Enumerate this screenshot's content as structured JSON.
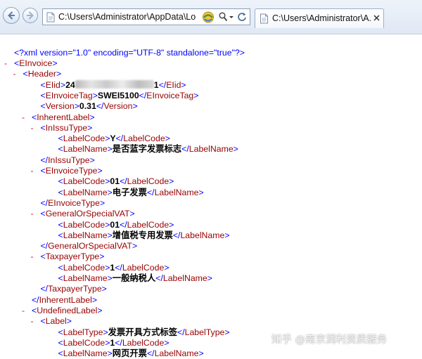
{
  "browser": {
    "address": "C:\\Users\\Administrator\\AppData\\Lo",
    "tab_title": "C:\\Users\\Administrator\\A...",
    "icons": [
      "back-icon",
      "forward-icon",
      "page-icon",
      "compat-view-icon",
      "search-icon",
      "dropdown-icon",
      "refresh-icon",
      "close-icon"
    ]
  },
  "xml": {
    "declaration": "<?xml version=\"1.0\" encoding=\"UTF-8\" standalone=\"true\"?>",
    "toggle_symbol": "-",
    "lines": [
      {
        "type": "open",
        "name": "EInvoice",
        "toggle": true
      },
      {
        "type": "open",
        "name": "Header",
        "toggle": true
      },
      {
        "type": "leaf",
        "name": "EIid",
        "value": "24",
        "redacted": true,
        "value_end": "1"
      },
      {
        "type": "leaf",
        "name": "EInvoiceTag",
        "value": "SWEI5100"
      },
      {
        "type": "leaf",
        "name": "Version",
        "value": "0.31"
      },
      {
        "type": "open",
        "name": "InherentLabel",
        "toggle": true
      },
      {
        "type": "open",
        "name": "InIssuType",
        "toggle": true
      },
      {
        "type": "leaf",
        "name": "LabelCode",
        "value": "Y"
      },
      {
        "type": "leaf",
        "name": "LabelName",
        "value": "是否蓝字发票标志"
      },
      {
        "type": "close",
        "name": "InIssuType"
      },
      {
        "type": "open",
        "name": "EInvoiceType",
        "toggle": true
      },
      {
        "type": "leaf",
        "name": "LabelCode",
        "value": "01"
      },
      {
        "type": "leaf",
        "name": "LabelName",
        "value": "电子发票"
      },
      {
        "type": "close",
        "name": "EInvoiceType"
      },
      {
        "type": "open",
        "name": "GeneralOrSpecialVAT",
        "toggle": true
      },
      {
        "type": "leaf",
        "name": "LabelCode",
        "value": "01"
      },
      {
        "type": "leaf",
        "name": "LabelName",
        "value": "增值税专用发票"
      },
      {
        "type": "close",
        "name": "GeneralOrSpecialVAT"
      },
      {
        "type": "open",
        "name": "TaxpayerType",
        "toggle": true
      },
      {
        "type": "leaf",
        "name": "LabelCode",
        "value": "1"
      },
      {
        "type": "leaf",
        "name": "LabelName",
        "value": "一般纳税人"
      },
      {
        "type": "close",
        "name": "TaxpayerType"
      },
      {
        "type": "close",
        "name": "InherentLabel"
      },
      {
        "type": "open",
        "name": "UndefinedLabel",
        "toggle": true
      },
      {
        "type": "open",
        "name": "Label",
        "toggle": true
      },
      {
        "type": "leaf",
        "name": "LabelType",
        "value": "发票开具方式标签"
      },
      {
        "type": "leaf",
        "name": "LabelCode",
        "value": "1"
      },
      {
        "type": "leaf",
        "name": "LabelName",
        "value": "网页开票"
      }
    ]
  },
  "watermark": "知乎 @南京润利资质服务",
  "colors": {
    "bracket": "#0000ff",
    "tag_name": "#990000",
    "value": "#000000",
    "toggle": "#dc143c",
    "chrome_bg": "#dfe8f4"
  }
}
